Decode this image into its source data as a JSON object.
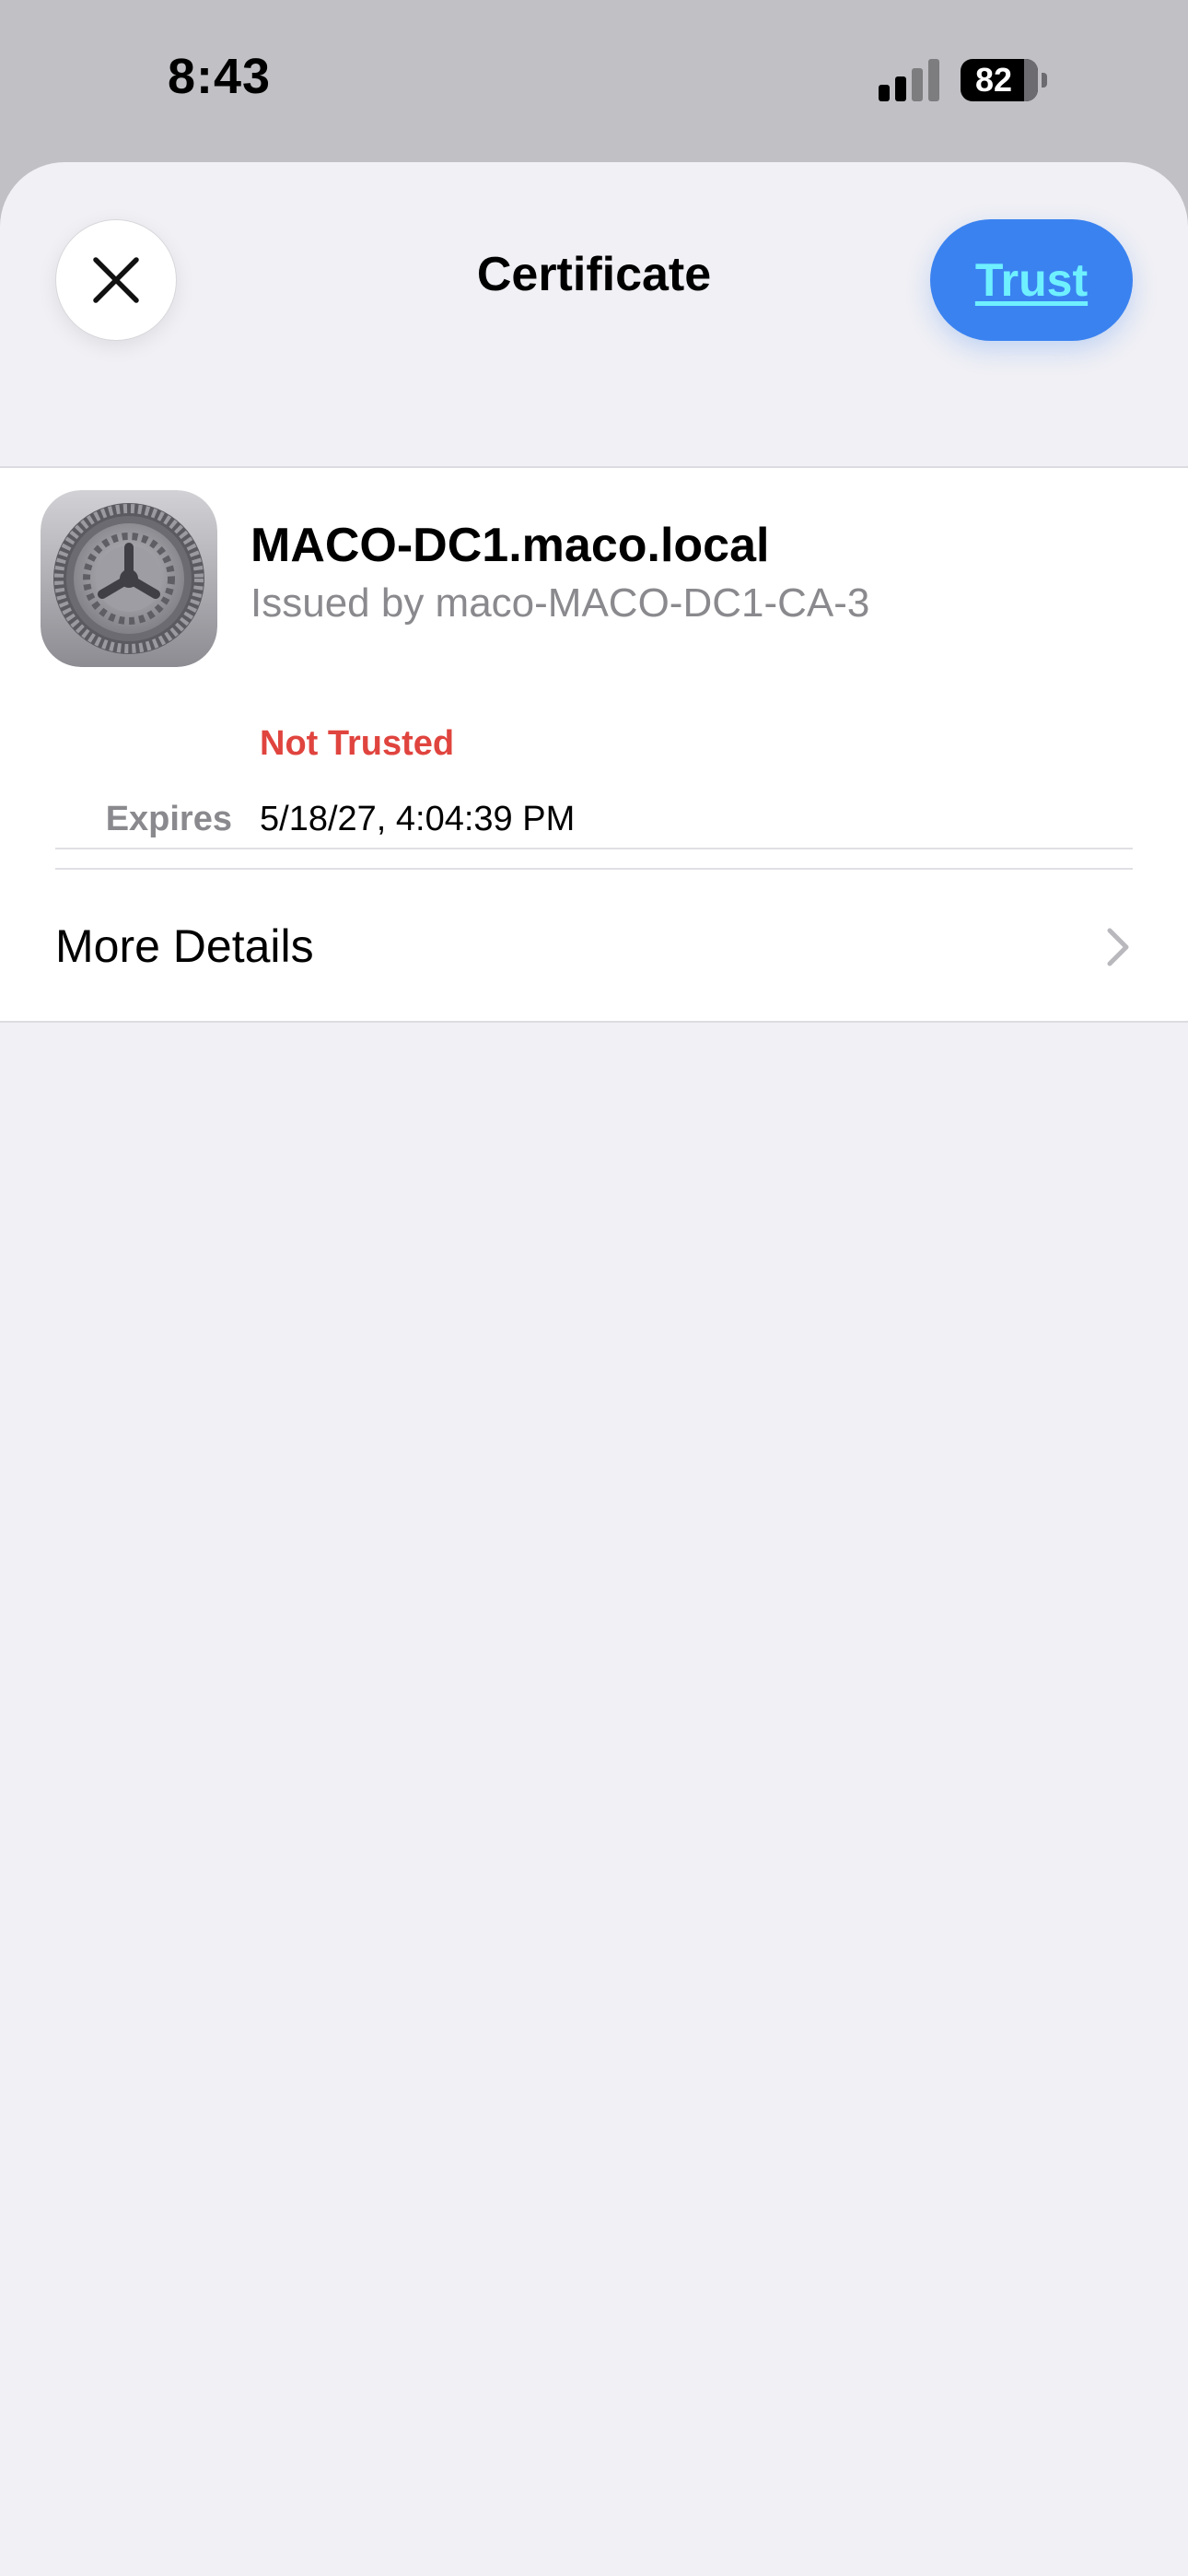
{
  "status_bar": {
    "time": "8:43",
    "battery_percent": "82",
    "icons": [
      "cellular-signal-icon",
      "battery-icon"
    ]
  },
  "sheet": {
    "title": "Certificate",
    "close_icon": "close-icon",
    "trust_label": "Trust"
  },
  "certificate": {
    "icon": "settings-gear-icon",
    "name": "MACO-DC1.maco.local",
    "issuer": "Issued by maco-MACO-DC1-CA-3",
    "status": "Not Trusted",
    "expires_label": "Expires",
    "expires_value": "5/18/27, 4:04:39 PM"
  },
  "more_details": {
    "label": "More Details",
    "icon": "chevron-right-icon"
  },
  "colors": {
    "accent": "#3a82f0",
    "trust_text": "#6ff0ff",
    "not_trusted": "#e0443e",
    "secondary_text": "#8a8a8e",
    "sheet_background": "#f0f0f5"
  }
}
